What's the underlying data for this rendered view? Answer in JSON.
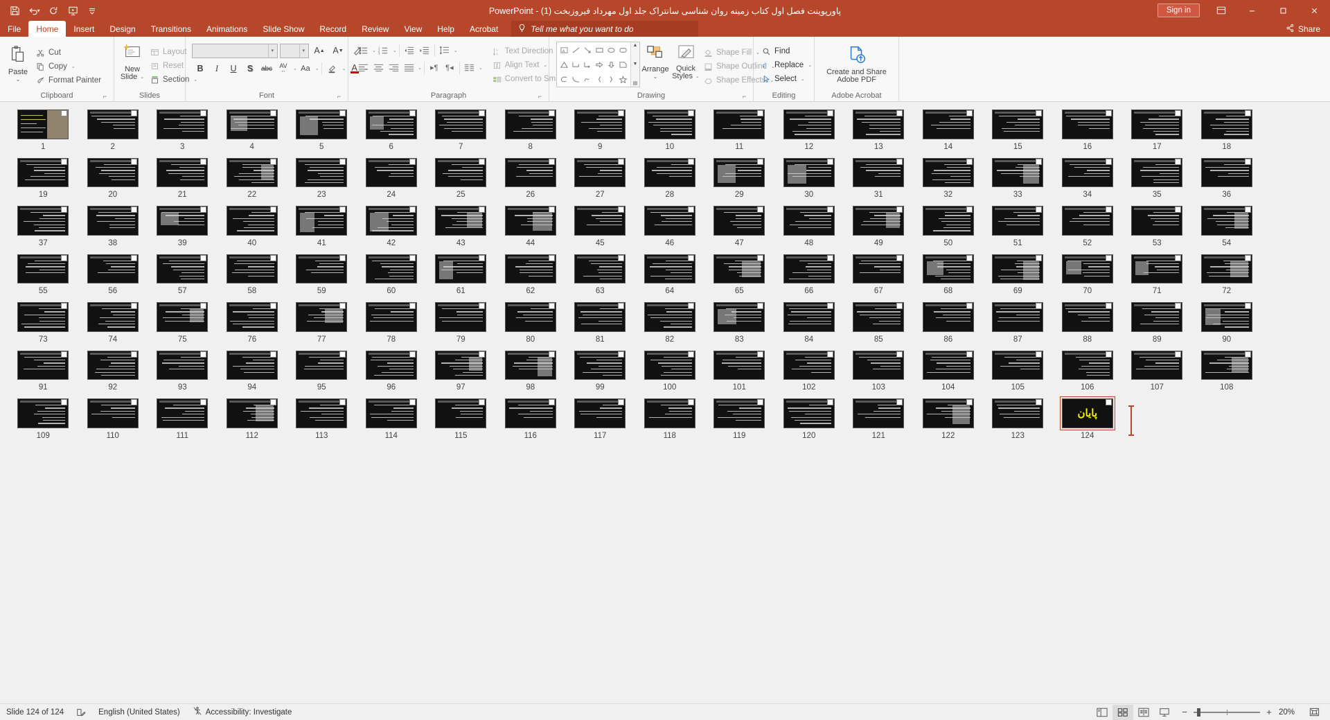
{
  "window": {
    "title": "پاورپوینت فصل اول کتاب زمینه روان شناسی سانتراک جلد اول مهرداد فیروزبخت (1)",
    "app_name": "PowerPoint",
    "separator": "-",
    "signin_label": "Sign in",
    "minimize": "minimize-icon",
    "maximize": "restore-icon",
    "close": "close-icon",
    "accent_color": "#b7472a"
  },
  "quick_access": [
    {
      "name": "save",
      "icon": "save-icon"
    },
    {
      "name": "undo",
      "icon": "undo-icon"
    },
    {
      "name": "redo",
      "icon": "redo-icon"
    },
    {
      "name": "start-from-beginning",
      "icon": "slideshow-icon"
    },
    {
      "name": "customize-qat",
      "icon": "chevron-down-icon"
    }
  ],
  "tabs": [
    {
      "label": "File",
      "active": false
    },
    {
      "label": "Home",
      "active": true
    },
    {
      "label": "Insert",
      "active": false
    },
    {
      "label": "Design",
      "active": false
    },
    {
      "label": "Transitions",
      "active": false
    },
    {
      "label": "Animations",
      "active": false
    },
    {
      "label": "Slide Show",
      "active": false
    },
    {
      "label": "Record",
      "active": false
    },
    {
      "label": "Review",
      "active": false
    },
    {
      "label": "View",
      "active": false
    },
    {
      "label": "Help",
      "active": false
    },
    {
      "label": "Acrobat",
      "active": false
    }
  ],
  "tell_me": {
    "placeholder": "Tell me what you want to do"
  },
  "share": {
    "label": "Share"
  },
  "ribbon": {
    "clipboard": {
      "group_label": "Clipboard",
      "paste_label": "Paste",
      "cut_label": "Cut",
      "copy_label": "Copy",
      "format_painter_label": "Format Painter"
    },
    "slides": {
      "group_label": "Slides",
      "new_slide_label_1": "New",
      "new_slide_label_2": "Slide",
      "layout_label": "Layout",
      "reset_label": "Reset",
      "section_label": "Section"
    },
    "font": {
      "group_label": "Font",
      "font_name_value": "",
      "font_size_value": "",
      "bold": "B",
      "italic": "I",
      "underline": "U",
      "shadow": "S",
      "strikethrough": "abc",
      "char_spacing": "AV",
      "change_case": "Aa",
      "text_highlight": "highlight-icon",
      "font_color": "A"
    },
    "paragraph": {
      "group_label": "Paragraph",
      "text_direction_label": "Text Direction",
      "align_text_label": "Align Text",
      "convert_smartart_label": "Convert to SmartArt"
    },
    "drawing": {
      "group_label": "Drawing",
      "arrange_label": "Arrange",
      "quick_styles_label_1": "Quick",
      "quick_styles_label_2": "Styles",
      "shape_fill_label": "Shape Fill",
      "shape_outline_label": "Shape Outline",
      "shape_effects_label": "Shape Effects"
    },
    "editing": {
      "group_label": "Editing",
      "find_label": "Find",
      "replace_label": "Replace",
      "select_label": "Select"
    },
    "acrobat": {
      "group_label": "Adobe Acrobat",
      "create_share_label_1": "Create and Share",
      "create_share_label_2": "Adobe PDF"
    }
  },
  "slides": {
    "count": 124,
    "selected": 124,
    "end_slide_text": "پایان",
    "numbers": [
      1,
      2,
      3,
      4,
      5,
      6,
      7,
      8,
      9,
      10,
      11,
      12,
      13,
      14,
      15,
      16,
      17,
      18,
      19,
      20,
      21,
      22,
      23,
      24,
      25,
      26,
      27,
      28,
      29,
      30,
      31,
      32,
      33,
      34,
      35,
      36,
      37,
      38,
      39,
      40,
      41,
      42,
      43,
      44,
      45,
      46,
      47,
      48,
      49,
      50,
      51,
      52,
      53,
      54,
      55,
      56,
      57,
      58,
      59,
      60,
      61,
      62,
      63,
      64,
      65,
      66,
      67,
      68,
      69,
      70,
      71,
      72,
      73,
      74,
      75,
      76,
      77,
      78,
      79,
      80,
      81,
      82,
      83,
      84,
      85,
      86,
      87,
      88,
      89,
      90,
      91,
      92,
      93,
      94,
      95,
      96,
      97,
      98,
      99,
      100,
      101,
      102,
      103,
      104,
      105,
      106,
      107,
      108,
      109,
      110,
      111,
      112,
      113,
      114,
      115,
      116,
      117,
      118,
      119,
      120,
      121,
      122,
      123,
      124
    ],
    "image_slides": [
      1,
      4,
      5,
      6,
      22,
      29,
      30,
      33,
      39,
      41,
      42,
      43,
      44,
      49,
      54,
      61,
      65,
      68,
      69,
      70,
      71,
      72,
      75,
      77,
      83,
      90,
      97,
      98,
      108,
      112,
      122
    ],
    "title_slide": 1,
    "layouts": {
      "1": "title-with-image",
      "18": "three-dots",
      "65": "document-scan",
      "68": "object-photo",
      "122": "table"
    }
  },
  "status_bar": {
    "slide_indicator": "Slide 124 of 124",
    "notes_icon": "notes-icon",
    "language": "English (United States)",
    "accessibility_icon": "accessibility-icon",
    "accessibility": "Accessibility: Investigate",
    "views": [
      {
        "name": "normal-view",
        "icon": "normal-view-icon",
        "active": false
      },
      {
        "name": "slide-sorter-view",
        "icon": "slide-sorter-icon",
        "active": true
      },
      {
        "name": "reading-view",
        "icon": "reading-view-icon",
        "active": false
      },
      {
        "name": "slide-show-view",
        "icon": "slideshow-view-icon",
        "active": false
      }
    ],
    "zoom_out": "−",
    "zoom_in": "+",
    "zoom_level": "20%",
    "fit_to_window": "fit-window-icon"
  }
}
